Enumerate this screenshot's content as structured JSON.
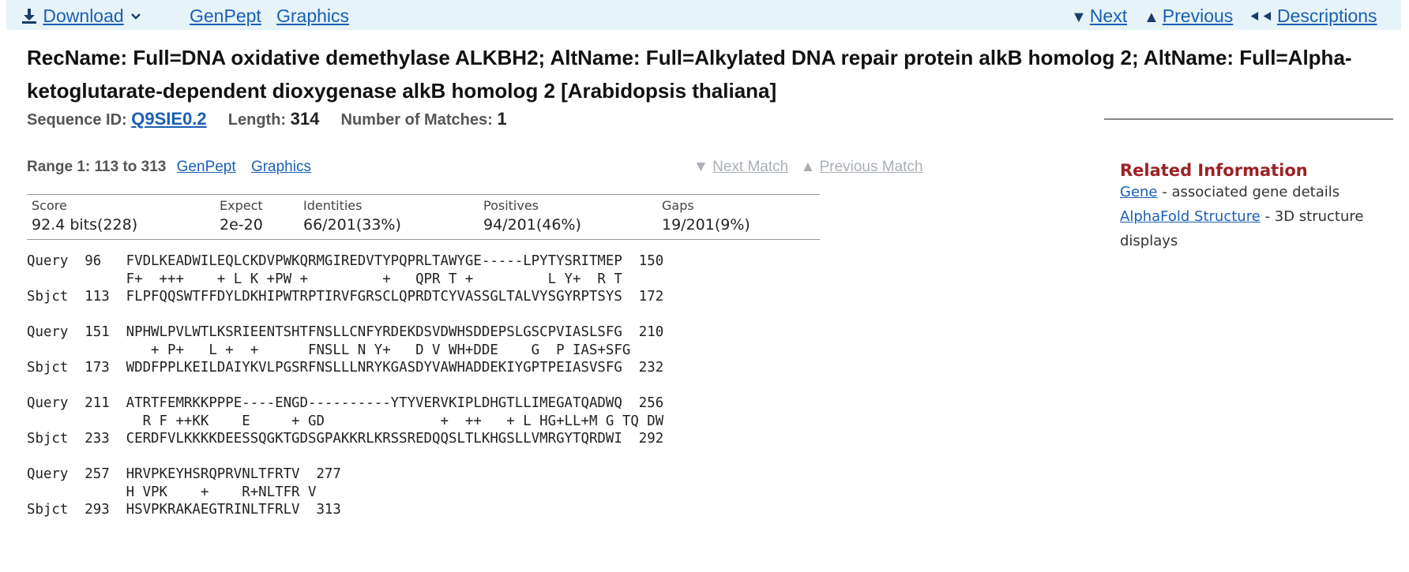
{
  "topbar": {
    "download_label": "Download",
    "genpept_label": "GenPept",
    "graphics_label": "Graphics",
    "next_label": "Next",
    "previous_label": "Previous",
    "descriptions_label": "Descriptions"
  },
  "title": "RecName: Full=DNA oxidative demethylase ALKBH2; AltName: Full=Alkylated DNA repair protein alkB homolog 2; AltName: Full=Alpha-ketoglutarate-dependent dioxygenase alkB homolog 2 [Arabidopsis thaliana]",
  "sequence": {
    "id_label": "Sequence ID:",
    "id_value": "Q9SIE0.2",
    "length_label": "Length:",
    "length_value": "314",
    "matches_label": "Number of Matches:",
    "matches_value": "1"
  },
  "range": {
    "title": "Range 1: 113 to 313",
    "genpept_label": "GenPept",
    "graphics_label": "Graphics",
    "next_match_label": "Next Match",
    "previous_match_label": "Previous Match"
  },
  "stats": {
    "score": {
      "label": "Score",
      "value": "92.4 bits(228)"
    },
    "expect": {
      "label": "Expect",
      "value": "2e-20"
    },
    "identities": {
      "label": "Identities",
      "value": "66/201(33%)"
    },
    "positives": {
      "label": "Positives",
      "value": "94/201(46%)"
    },
    "gaps": {
      "label": "Gaps",
      "value": "19/201(9%)"
    }
  },
  "alignment": [
    {
      "query": "Query  96   FVDLKEADWILEQLCKDVPWKQRMGIREDVTYPQPRLTAWYGE-----LPYTYSRITMEP  150",
      "match": "            F+  +++    + L K +PW +         +   QPR T +         L Y+  R T    ",
      "sbjct": "Sbjct  113  FLPFQQSWTFFDYLDKHIPWTRPTIRVFGRSCLQPRDTCYVASSGLTALVYSGYRPTSYS  172"
    },
    {
      "query": "Query  151  NPHWLPVLWTLKSRIEENTSHTFNSLLCNFYRDEKDSVDWHSDDEPSLGSCPVIASLSFG  210",
      "match": "               + P+   L +  +      FNSLL N Y+   D V WH+DDE    G  P IAS+SFG    ",
      "sbjct": "Sbjct  173  WDDFPPLKEILDAIYKVLPGSRFNSLLLNRYKGASDYVAWHADDEKIYGPTPEIASVSFG  232"
    },
    {
      "query": "Query  211  ATRTFEMRKKPPPE----ENGD----------YTYVERVKIPLDHGTLLIMEGATQADWQ  256",
      "match": "              R F ++KK    E     + GD              +  ++   + L HG+LL+M G TQ DW    ",
      "sbjct": "Sbjct  233  CERDFVLKKKKDEESSQGKTGDSGPAKKRLKRSSREDQQSLTLKHGSLLVMRGYTQRDWI  292"
    },
    {
      "query": "Query  257  HRVPKEYHSRQPRVNLTFRTV  277",
      "match": "            H VPK    +    R+NLTFR V",
      "sbjct": "Sbjct  293  HSVPKRAKAEGTRINLTFRLV  313"
    }
  ],
  "related": {
    "heading": "Related Information",
    "gene_link": "Gene",
    "gene_desc": " - associated gene details",
    "alphafold_link": "AlphaFold Structure",
    "alphafold_desc": " - 3D structure displays"
  }
}
